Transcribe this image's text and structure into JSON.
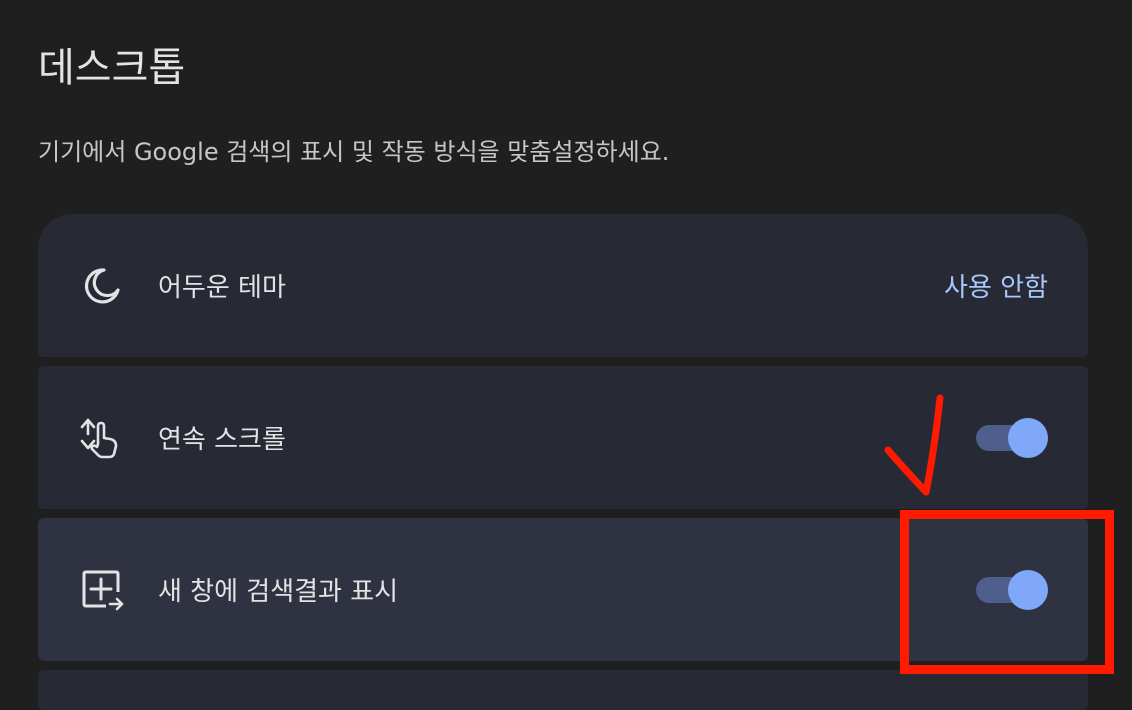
{
  "header": {
    "title": "데스크톱",
    "subtitle": "기기에서 Google 검색의 표시 및 작동 방식을 맞춤설정하세요."
  },
  "settings": [
    {
      "icon": "moon-icon",
      "label": "어두운 테마",
      "value": "사용 안함"
    },
    {
      "icon": "scroll-gesture-icon",
      "label": "연속 스크롤",
      "toggle_on": true
    },
    {
      "icon": "open-in-new-window-icon",
      "label": "새 창에 검색결과 표시",
      "toggle_on": true
    }
  ],
  "colors": {
    "background": "#1f1f1f",
    "card": "#272a35",
    "card_hover": "#2f3241",
    "accent_text": "#a8c7fa",
    "toggle_track": "#4e5f8d",
    "toggle_knob": "#7fa8f8",
    "annotation": "#ff1a00"
  }
}
